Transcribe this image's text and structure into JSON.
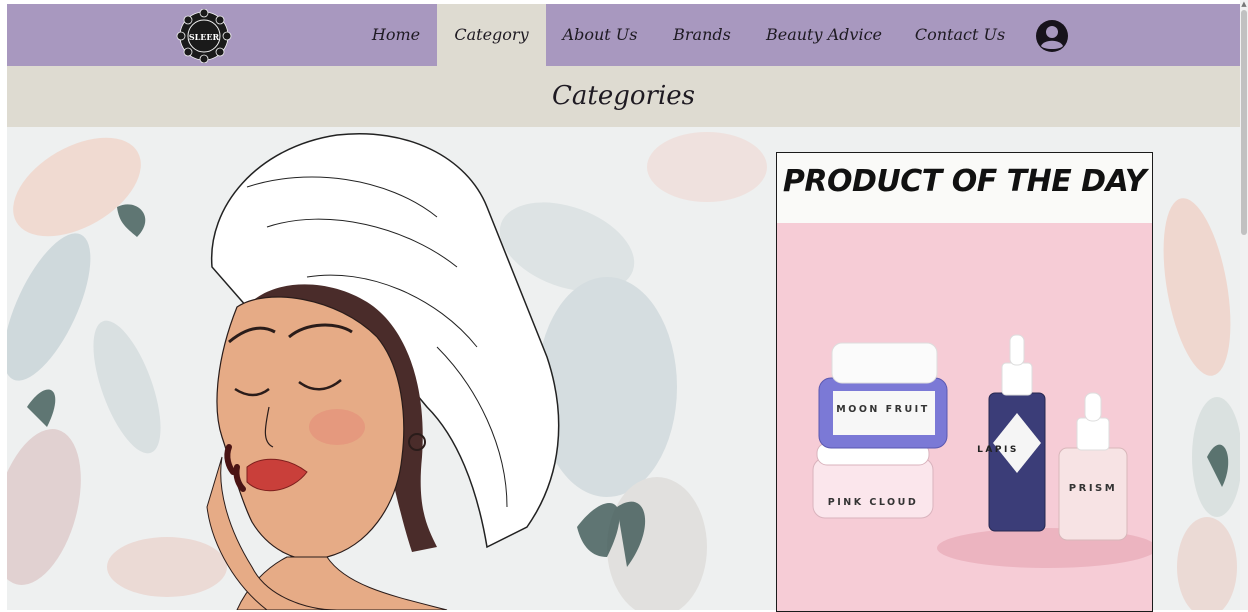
{
  "nav": {
    "items": [
      {
        "label": "Home",
        "active": false
      },
      {
        "label": "Category",
        "active": true
      },
      {
        "label": "About Us",
        "active": false
      },
      {
        "label": "Brands",
        "active": false
      },
      {
        "label": "Beauty Advice",
        "active": false
      },
      {
        "label": "Contact Us",
        "active": false
      }
    ],
    "logo_text": "SLEER",
    "user_icon": "account-circle-icon"
  },
  "page": {
    "title": "Categories"
  },
  "product_of_the_day": {
    "heading": "PRODUCT OF THE DAY",
    "products": [
      {
        "label": "MOON FRUIT"
      },
      {
        "label": "LAPIS"
      },
      {
        "label": "PRISM"
      },
      {
        "label": "PINK CLOUD"
      }
    ]
  },
  "colors": {
    "nav_bg": "#a898bf",
    "title_bg": "#dedbd1",
    "card_bg": "#f6ccd6"
  }
}
